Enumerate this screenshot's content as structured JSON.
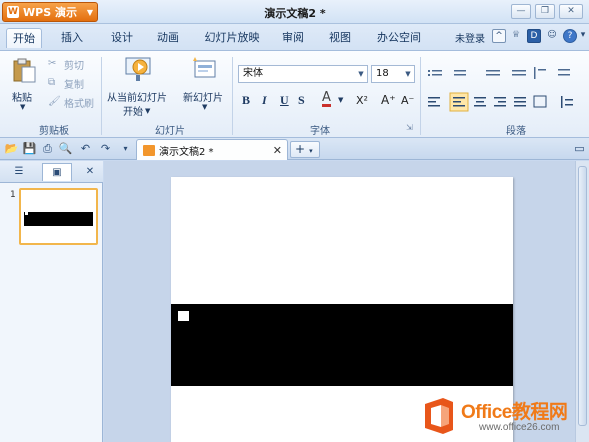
{
  "app": {
    "menu_label": "WPS 演示",
    "doc_title": "演示文稿2 *"
  },
  "tabs": [
    {
      "label": "开始",
      "active": true
    },
    {
      "label": "插入"
    },
    {
      "label": "设计"
    },
    {
      "label": "动画"
    },
    {
      "label": "幻灯片放映"
    },
    {
      "label": "审阅"
    },
    {
      "label": "视图"
    },
    {
      "label": "办公空间"
    }
  ],
  "account": {
    "login_label": "未登录"
  },
  "ribbon": {
    "clipboard": {
      "paste": "粘贴",
      "cut": "剪切",
      "copy": "复制",
      "format_painter": "格式刷",
      "group": "剪贴板"
    },
    "slides": {
      "from_current_line1": "从当前幻灯片",
      "from_current_line2": "开始",
      "new_slide": "新幻灯片",
      "group": "幻灯片"
    },
    "font": {
      "name": "宋体",
      "size": "18",
      "bold": "B",
      "italic": "I",
      "underline": "U",
      "strike": "S",
      "color": "A",
      "superscript": "X²",
      "grow": "A⁺",
      "shrink": "A⁻",
      "group": "字体"
    },
    "paragraph": {
      "group": "段落"
    }
  },
  "doc_tab": {
    "label": "演示文稿2 *"
  },
  "watermark": {
    "title": "Office教程网",
    "url": "www.office26.com"
  },
  "colors": {
    "accent": "#e36f0e",
    "ribbon_bg": "#e4edf8",
    "thumb_border": "#f2b64c"
  }
}
